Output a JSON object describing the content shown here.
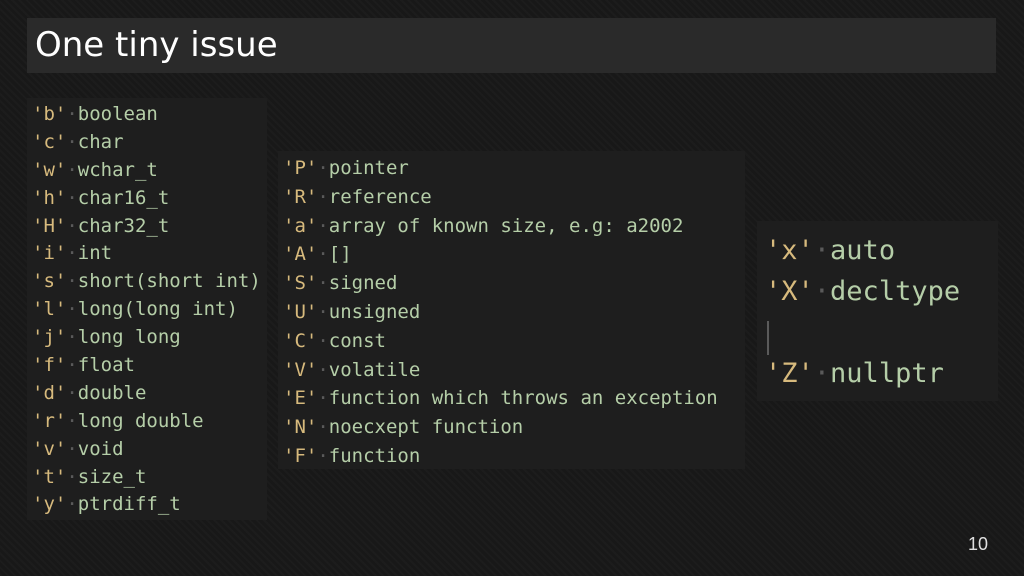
{
  "slide": {
    "title": "One tiny issue",
    "page_number": "10"
  },
  "panel1": [
    {
      "code": "'b'",
      "desc": "boolean"
    },
    {
      "code": "'c'",
      "desc": "char"
    },
    {
      "code": "'w'",
      "desc": "wchar_t"
    },
    {
      "code": "'h'",
      "desc": "char16_t"
    },
    {
      "code": "'H'",
      "desc": "char32_t"
    },
    {
      "code": "'i'",
      "desc": "int"
    },
    {
      "code": "'s'",
      "desc": "short(short int)"
    },
    {
      "code": "'l'",
      "desc": "long(long int)"
    },
    {
      "code": "'j'",
      "desc": "long long"
    },
    {
      "code": "'f'",
      "desc": "float"
    },
    {
      "code": "'d'",
      "desc": "double"
    },
    {
      "code": "'r'",
      "desc": "long double"
    },
    {
      "code": "'v'",
      "desc": "void"
    },
    {
      "code": "'t'",
      "desc": "size_t"
    },
    {
      "code": "'y'",
      "desc": "ptrdiff_t"
    }
  ],
  "panel2": [
    {
      "code": "'P'",
      "desc": "pointer"
    },
    {
      "code": "'R'",
      "desc": "reference"
    },
    {
      "code": "'a'",
      "desc": "array of known size, e.g: a2002"
    },
    {
      "code": "'A'",
      "desc": "[]"
    },
    {
      "code": "'S'",
      "desc": "signed"
    },
    {
      "code": "'U'",
      "desc": "unsigned"
    },
    {
      "code": "'C'",
      "desc": "const"
    },
    {
      "code": "'V'",
      "desc": "volatile"
    },
    {
      "code": "'E'",
      "desc": "function which throws an exception"
    },
    {
      "code": "'N'",
      "desc": "noecxept function"
    },
    {
      "code": "'F'",
      "desc": "function"
    }
  ],
  "panel3": [
    {
      "code": "'x'",
      "desc": "auto"
    },
    {
      "code": "'X'",
      "desc": "decltype"
    },
    {
      "code": "'Z'",
      "desc": "nullptr"
    }
  ],
  "colors": {
    "background": "#181818",
    "title_bar": "#2a2a2a",
    "code_panel": "#1e1e1e",
    "code_letter": "#d7ba7d",
    "description": "#b5cea8",
    "whitespace_dot": "#5a5a5a"
  }
}
